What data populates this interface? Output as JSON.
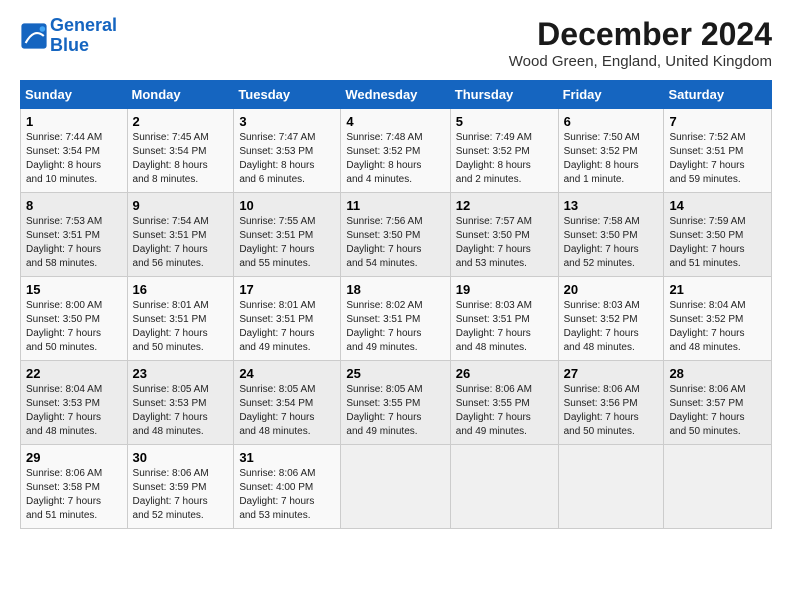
{
  "logo": {
    "line1": "General",
    "line2": "Blue"
  },
  "title": "December 2024",
  "location": "Wood Green, England, United Kingdom",
  "headers": [
    "Sunday",
    "Monday",
    "Tuesday",
    "Wednesday",
    "Thursday",
    "Friday",
    "Saturday"
  ],
  "weeks": [
    [
      {
        "day": "1",
        "info": "Sunrise: 7:44 AM\nSunset: 3:54 PM\nDaylight: 8 hours\nand 10 minutes."
      },
      {
        "day": "2",
        "info": "Sunrise: 7:45 AM\nSunset: 3:54 PM\nDaylight: 8 hours\nand 8 minutes."
      },
      {
        "day": "3",
        "info": "Sunrise: 7:47 AM\nSunset: 3:53 PM\nDaylight: 8 hours\nand 6 minutes."
      },
      {
        "day": "4",
        "info": "Sunrise: 7:48 AM\nSunset: 3:52 PM\nDaylight: 8 hours\nand 4 minutes."
      },
      {
        "day": "5",
        "info": "Sunrise: 7:49 AM\nSunset: 3:52 PM\nDaylight: 8 hours\nand 2 minutes."
      },
      {
        "day": "6",
        "info": "Sunrise: 7:50 AM\nSunset: 3:52 PM\nDaylight: 8 hours\nand 1 minute."
      },
      {
        "day": "7",
        "info": "Sunrise: 7:52 AM\nSunset: 3:51 PM\nDaylight: 7 hours\nand 59 minutes."
      }
    ],
    [
      {
        "day": "8",
        "info": "Sunrise: 7:53 AM\nSunset: 3:51 PM\nDaylight: 7 hours\nand 58 minutes."
      },
      {
        "day": "9",
        "info": "Sunrise: 7:54 AM\nSunset: 3:51 PM\nDaylight: 7 hours\nand 56 minutes."
      },
      {
        "day": "10",
        "info": "Sunrise: 7:55 AM\nSunset: 3:51 PM\nDaylight: 7 hours\nand 55 minutes."
      },
      {
        "day": "11",
        "info": "Sunrise: 7:56 AM\nSunset: 3:50 PM\nDaylight: 7 hours\nand 54 minutes."
      },
      {
        "day": "12",
        "info": "Sunrise: 7:57 AM\nSunset: 3:50 PM\nDaylight: 7 hours\nand 53 minutes."
      },
      {
        "day": "13",
        "info": "Sunrise: 7:58 AM\nSunset: 3:50 PM\nDaylight: 7 hours\nand 52 minutes."
      },
      {
        "day": "14",
        "info": "Sunrise: 7:59 AM\nSunset: 3:50 PM\nDaylight: 7 hours\nand 51 minutes."
      }
    ],
    [
      {
        "day": "15",
        "info": "Sunrise: 8:00 AM\nSunset: 3:50 PM\nDaylight: 7 hours\nand 50 minutes."
      },
      {
        "day": "16",
        "info": "Sunrise: 8:01 AM\nSunset: 3:51 PM\nDaylight: 7 hours\nand 50 minutes."
      },
      {
        "day": "17",
        "info": "Sunrise: 8:01 AM\nSunset: 3:51 PM\nDaylight: 7 hours\nand 49 minutes."
      },
      {
        "day": "18",
        "info": "Sunrise: 8:02 AM\nSunset: 3:51 PM\nDaylight: 7 hours\nand 49 minutes."
      },
      {
        "day": "19",
        "info": "Sunrise: 8:03 AM\nSunset: 3:51 PM\nDaylight: 7 hours\nand 48 minutes."
      },
      {
        "day": "20",
        "info": "Sunrise: 8:03 AM\nSunset: 3:52 PM\nDaylight: 7 hours\nand 48 minutes."
      },
      {
        "day": "21",
        "info": "Sunrise: 8:04 AM\nSunset: 3:52 PM\nDaylight: 7 hours\nand 48 minutes."
      }
    ],
    [
      {
        "day": "22",
        "info": "Sunrise: 8:04 AM\nSunset: 3:53 PM\nDaylight: 7 hours\nand 48 minutes."
      },
      {
        "day": "23",
        "info": "Sunrise: 8:05 AM\nSunset: 3:53 PM\nDaylight: 7 hours\nand 48 minutes."
      },
      {
        "day": "24",
        "info": "Sunrise: 8:05 AM\nSunset: 3:54 PM\nDaylight: 7 hours\nand 48 minutes."
      },
      {
        "day": "25",
        "info": "Sunrise: 8:05 AM\nSunset: 3:55 PM\nDaylight: 7 hours\nand 49 minutes."
      },
      {
        "day": "26",
        "info": "Sunrise: 8:06 AM\nSunset: 3:55 PM\nDaylight: 7 hours\nand 49 minutes."
      },
      {
        "day": "27",
        "info": "Sunrise: 8:06 AM\nSunset: 3:56 PM\nDaylight: 7 hours\nand 50 minutes."
      },
      {
        "day": "28",
        "info": "Sunrise: 8:06 AM\nSunset: 3:57 PM\nDaylight: 7 hours\nand 50 minutes."
      }
    ],
    [
      {
        "day": "29",
        "info": "Sunrise: 8:06 AM\nSunset: 3:58 PM\nDaylight: 7 hours\nand 51 minutes."
      },
      {
        "day": "30",
        "info": "Sunrise: 8:06 AM\nSunset: 3:59 PM\nDaylight: 7 hours\nand 52 minutes."
      },
      {
        "day": "31",
        "info": "Sunrise: 8:06 AM\nSunset: 4:00 PM\nDaylight: 7 hours\nand 53 minutes."
      },
      {
        "day": "",
        "info": ""
      },
      {
        "day": "",
        "info": ""
      },
      {
        "day": "",
        "info": ""
      },
      {
        "day": "",
        "info": ""
      }
    ]
  ]
}
